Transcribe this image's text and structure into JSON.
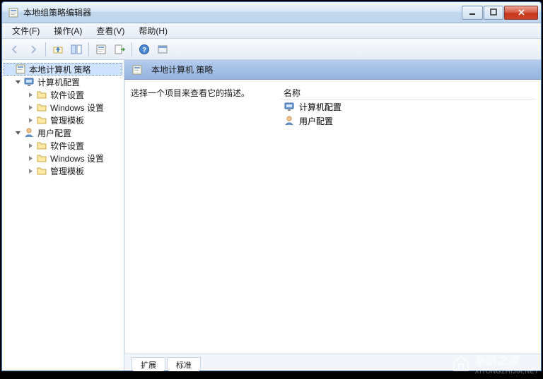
{
  "window": {
    "title": "本地组策略编辑器"
  },
  "menu": {
    "file": "文件(F)",
    "action": "操作(A)",
    "view": "查看(V)",
    "help": "帮助(H)"
  },
  "tree": {
    "root": "本地计算机 策略",
    "computer": "计算机配置",
    "user": "用户配置",
    "software": "软件设置",
    "windows": "Windows 设置",
    "templates": "管理模板"
  },
  "panel": {
    "header_title": "本地计算机 策略",
    "description": "选择一个项目来查看它的描述。",
    "column_name": "名称",
    "items": {
      "computer": "计算机配置",
      "user": "用户配置"
    }
  },
  "tabs": {
    "ext": "扩展",
    "std": "标准"
  },
  "watermark": {
    "text": "系统之家",
    "url": "XITONGZHIJIA.NET"
  }
}
